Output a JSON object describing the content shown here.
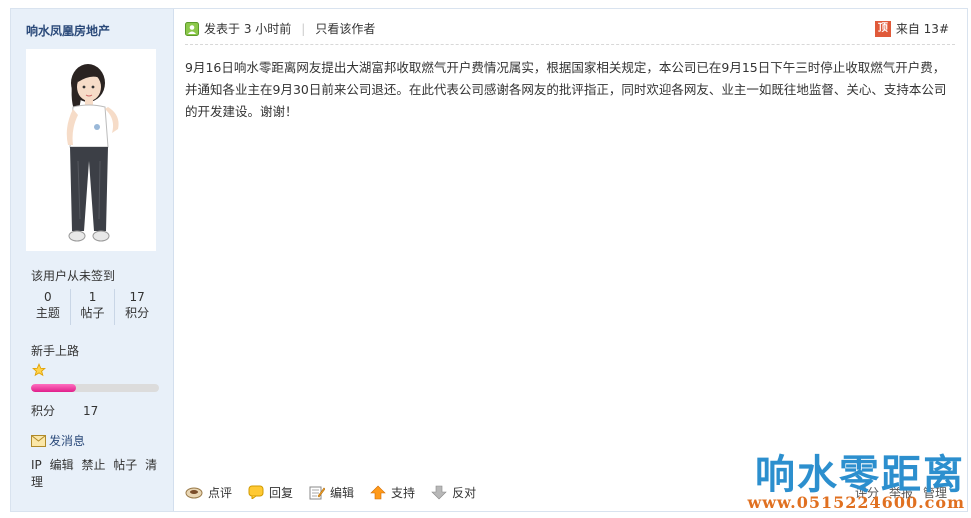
{
  "sidebar": {
    "username": "响水凤凰房地产",
    "sign_status": "该用户从未签到",
    "stats": [
      {
        "value": "0",
        "label": "主题"
      },
      {
        "value": "1",
        "label": "帖子"
      },
      {
        "value": "17",
        "label": "积分"
      }
    ],
    "level_name": "新手上路",
    "level_progress_percent": 35,
    "score_label": "积分",
    "score_value": "17",
    "send_message": "发消息",
    "admin_actions": [
      "IP",
      "编辑",
      "禁止",
      "帖子",
      "清理"
    ],
    "colors": {
      "bar_fill": "#e01f8b",
      "panel_bg": "#e8f0f9"
    }
  },
  "post_header": {
    "posted_prefix": "发表于",
    "posted_time": "3 小时前",
    "author_only": "只看该作者",
    "top_badge": "顶",
    "floor_label": "来自 13#"
  },
  "post_body": "9月16日响水零距离网友提出大湖富邦收取燃气开户费情况属实，根据国家相关规定，本公司已在9月15日下午三时停止收取燃气开户费，并通知各业主在9月30日前来公司退还。在此代表公司感谢各网友的批评指正，同时欢迎各网友、业主一如既往地监督、关心、支持本公司的开发建设。谢谢！",
  "footer": {
    "actions": [
      {
        "label": "点评",
        "icon": "comment-icon"
      },
      {
        "label": "回复",
        "icon": "reply-icon"
      },
      {
        "label": "编辑",
        "icon": "edit-icon"
      },
      {
        "label": "支持",
        "icon": "thumb-up-arrow-icon"
      },
      {
        "label": "反对",
        "icon": "thumb-down-arrow-icon"
      }
    ],
    "right_actions": [
      "评分",
      "举报",
      "管理"
    ]
  },
  "watermark": {
    "title": "响水零距离",
    "url": "www.0515224600.com"
  }
}
